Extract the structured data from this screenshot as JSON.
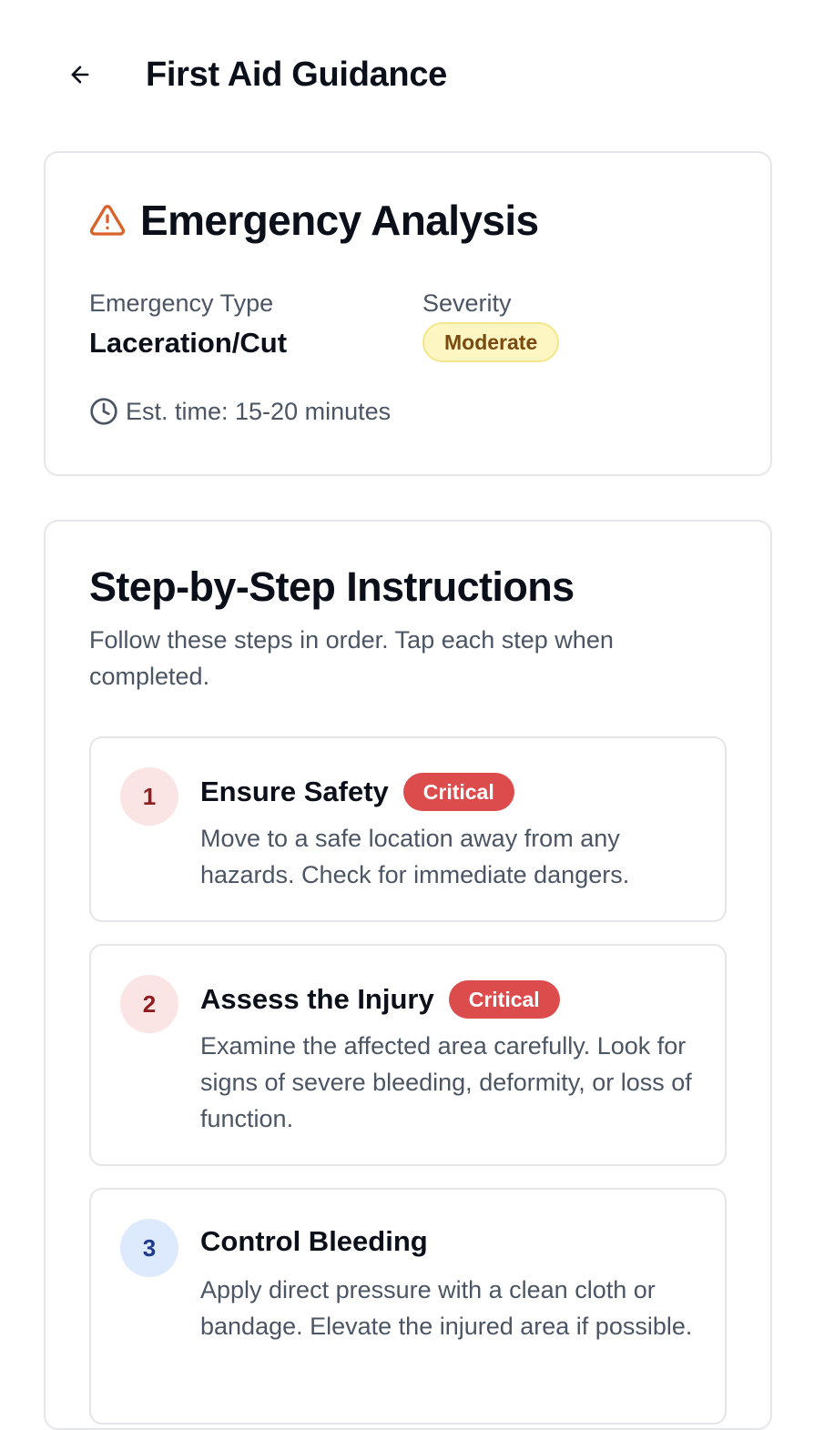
{
  "header": {
    "title": "First Aid Guidance",
    "back_icon": "arrow-left-icon"
  },
  "analysis": {
    "title": "Emergency Analysis",
    "icon": "alert-triangle-icon",
    "type_label": "Emergency Type",
    "type_value": "Laceration/Cut",
    "severity_label": "Severity",
    "severity_value": "Moderate",
    "est_time": "Est. time: 15-20 minutes",
    "colors": {
      "alert_icon": "#d9622b",
      "severity_bg": "#fdf6c3",
      "severity_text": "#7a4a0e"
    }
  },
  "instructions": {
    "title": "Step-by-Step Instructions",
    "subtitle": "Follow these steps in order. Tap each step when completed.",
    "steps": [
      {
        "number": "1",
        "title": "Ensure Safety",
        "badge": "Critical",
        "description": "Move to a safe location away from any hazards. Check for immediate dangers."
      },
      {
        "number": "2",
        "title": "Assess the Injury",
        "badge": "Critical",
        "description": "Examine the affected area carefully. Look for signs of severe bleeding, deformity, or loss of function."
      },
      {
        "number": "3",
        "title": "Control Bleeding",
        "badge": "",
        "description": "Apply direct pressure with a clean cloth or bandage. Elevate the injured area if possible."
      }
    ],
    "colors": {
      "critical": "#dc4c4c",
      "critical_number_bg": "#fbe4e4",
      "normal_number_bg": "#dde9fc"
    }
  }
}
